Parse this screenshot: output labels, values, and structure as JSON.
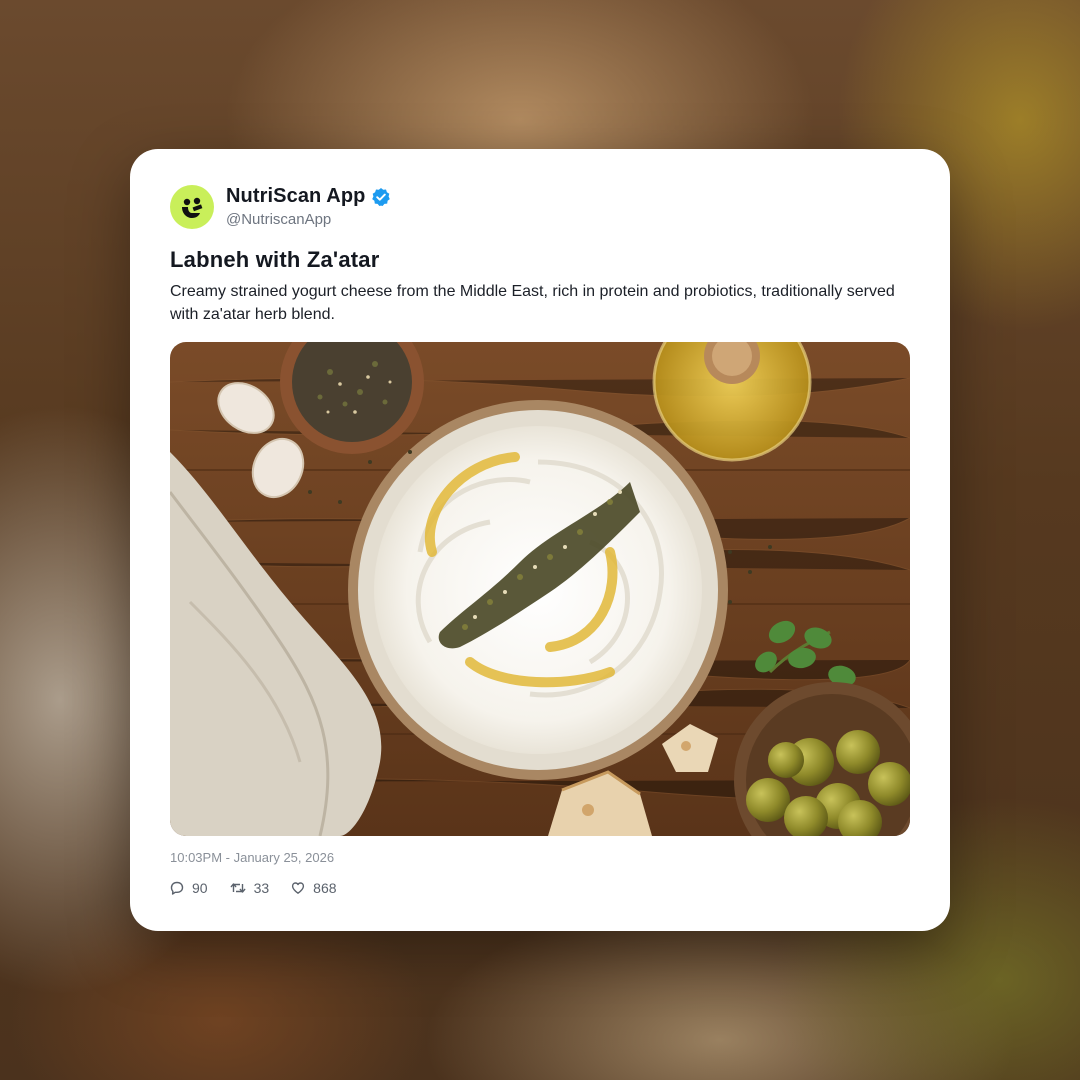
{
  "post": {
    "author": {
      "name": "NutriScan App",
      "handle": "@NutriscanApp",
      "verified": true,
      "avatar_color": "#c9ef5a"
    },
    "title": "Labneh with Za'atar",
    "description": "Creamy strained yogurt cheese from the Middle East, rich in protein and probiotics, traditionally served with za'atar herb blend.",
    "image_icon": "food-photo",
    "timestamp": "10:03PM - January 25, 2026",
    "stats": {
      "replies": "90",
      "retweets": "33",
      "likes": "868"
    }
  },
  "colors": {
    "verified_badge": "#1d9bf0",
    "text_primary": "#141820",
    "text_secondary": "#6e7580"
  }
}
